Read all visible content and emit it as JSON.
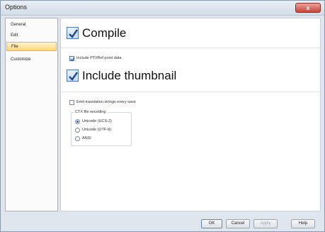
{
  "window": {
    "title": "Options",
    "close_label": "x"
  },
  "sidebar": {
    "items": [
      {
        "label": "General"
      },
      {
        "label": "Edit"
      },
      {
        "label": "File"
      },
      {
        "label": "Customize"
      }
    ],
    "selected": "File"
  },
  "options": {
    "compile": {
      "label": "Compile",
      "checked": true
    },
    "include_pti": {
      "label": "Include PTI/Ref point data",
      "checked": true
    },
    "include_thumbnail": {
      "label": "Include thumbnail",
      "checked": true
    },
    "emit_translation": {
      "label": "Emit translation strings every save",
      "checked": false
    }
  },
  "ctx_encoding": {
    "legend": "CTX file encoding",
    "options": [
      {
        "label": "Unicode (UCS-2)",
        "selected": true
      },
      {
        "label": "Unicode (UTF-8)",
        "selected": false
      },
      {
        "label": "ANSI",
        "selected": false
      }
    ]
  },
  "buttons": {
    "ok": "OK",
    "cancel": "Cancel",
    "apply": "Apply",
    "help": "Help"
  },
  "colors": {
    "accent": "#4f77b3",
    "selection": "#ffd57a"
  }
}
